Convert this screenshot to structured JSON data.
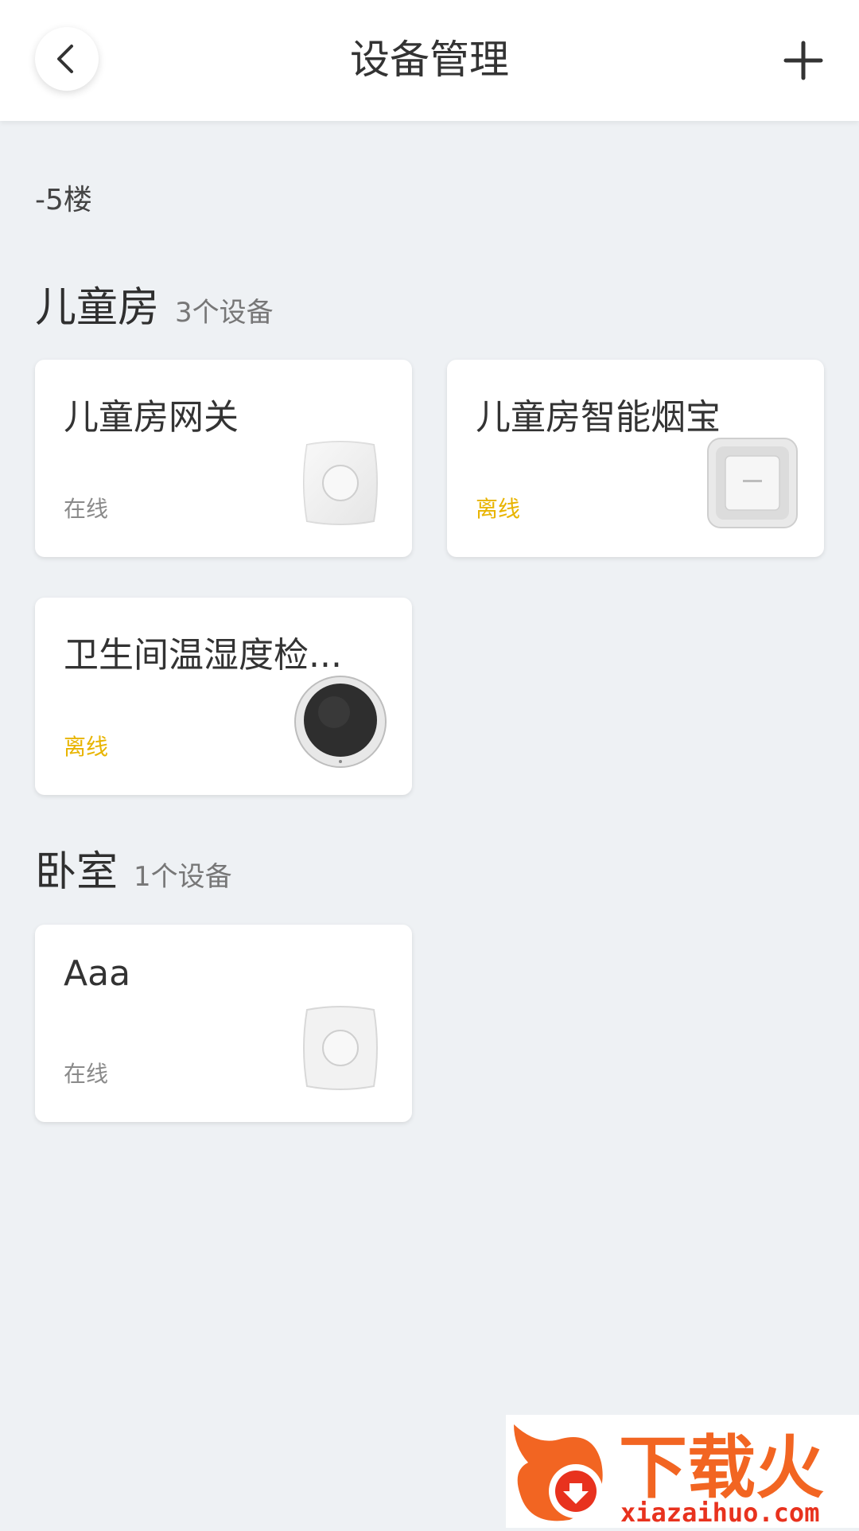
{
  "header": {
    "title": "设备管理"
  },
  "floor": {
    "label": "-5楼"
  },
  "rooms": [
    {
      "name": "儿童房",
      "count": "3个设备",
      "devices": [
        {
          "name": "儿童房网关",
          "status": "在线",
          "icon": "gateway-icon"
        },
        {
          "name": "儿童房智能烟宝",
          "status": "离线",
          "icon": "smoke-detector-icon"
        },
        {
          "name": "卫生间温湿度检...",
          "status": "离线",
          "icon": "thermo-hygrometer-icon"
        }
      ]
    },
    {
      "name": "卧室",
      "count": "1个设备",
      "devices": [
        {
          "name": "Aaa",
          "status": "在线",
          "icon": "gateway-icon"
        }
      ]
    }
  ],
  "watermark": {
    "brand": "下载火",
    "site": "xiazaihuo.com"
  },
  "colors": {
    "offline": "#e8b400",
    "online": "#8a8a8a",
    "background": "#eef1f4"
  }
}
